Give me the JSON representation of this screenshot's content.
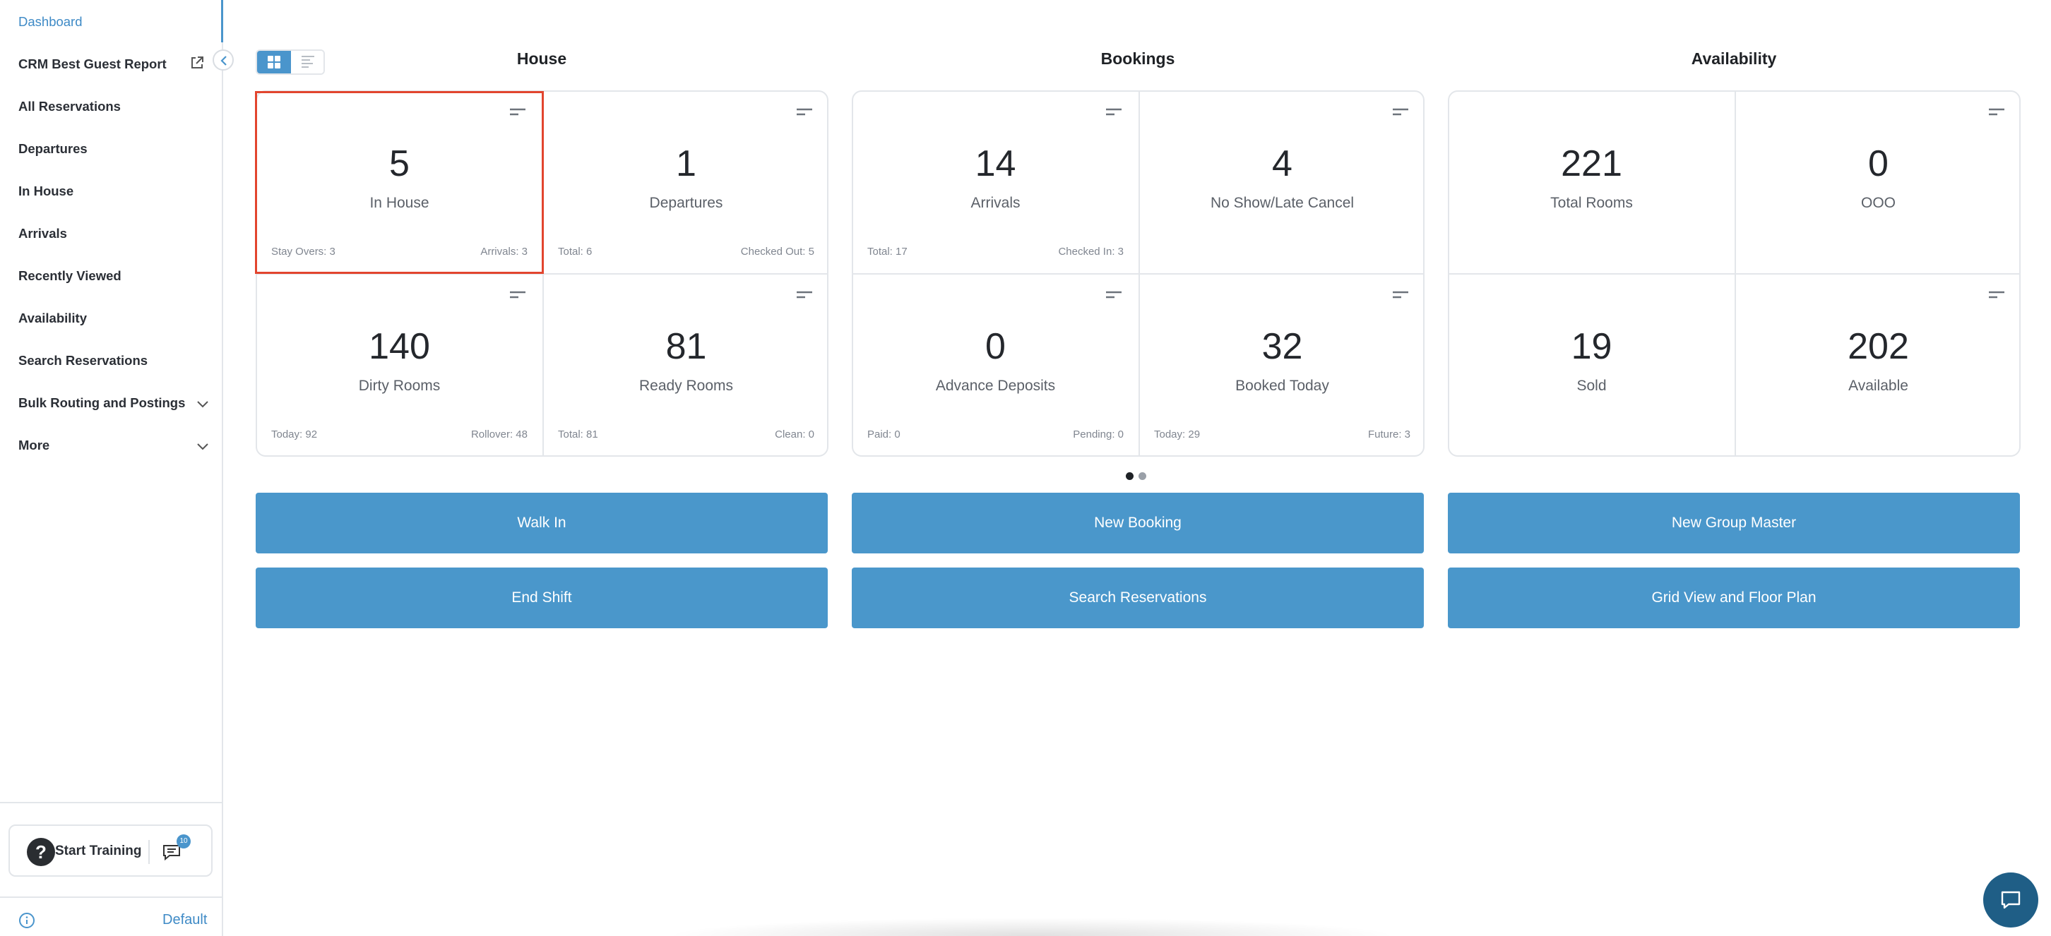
{
  "sidebar": {
    "items": [
      {
        "label": "Dashboard",
        "active": true
      },
      {
        "label": "CRM Best Guest Report",
        "external": true
      },
      {
        "label": "All Reservations"
      },
      {
        "label": "Departures"
      },
      {
        "label": "In House"
      },
      {
        "label": "Arrivals"
      },
      {
        "label": "Recently Viewed"
      },
      {
        "label": "Availability"
      },
      {
        "label": "Search Reservations"
      },
      {
        "label": "Bulk Routing and Postings",
        "expandable": true
      },
      {
        "label": "More",
        "expandable": true
      }
    ],
    "training_label": "Start Training",
    "chat_badge": "10",
    "footer_link": "Default"
  },
  "sections": [
    {
      "title": "House",
      "tiles": [
        {
          "value": "5",
          "label": "In House",
          "foot_left": "Stay Overs: 3",
          "foot_right": "Arrivals: 3"
        },
        {
          "value": "1",
          "label": "Departures",
          "foot_left": "Total: 6",
          "foot_right": "Checked Out: 5"
        },
        {
          "value": "140",
          "label": "Dirty Rooms",
          "foot_left": "Today: 92",
          "foot_right": "Rollover: 48"
        },
        {
          "value": "81",
          "label": "Ready Rooms",
          "foot_left": "Total: 81",
          "foot_right": "Clean: 0"
        }
      ]
    },
    {
      "title": "Bookings",
      "tiles": [
        {
          "value": "14",
          "label": "Arrivals",
          "foot_left": "Total: 17",
          "foot_right": "Checked In: 3"
        },
        {
          "value": "4",
          "label": "No Show/Late Cancel",
          "foot_left": "",
          "foot_right": ""
        },
        {
          "value": "0",
          "label": "Advance Deposits",
          "foot_left": "Paid: 0",
          "foot_right": "Pending: 0"
        },
        {
          "value": "32",
          "label": "Booked Today",
          "foot_left": "Today: 29",
          "foot_right": "Future: 3"
        }
      ]
    },
    {
      "title": "Availability",
      "tiles": [
        {
          "value": "221",
          "label": "Total Rooms",
          "foot_left": "",
          "foot_right": ""
        },
        {
          "value": "0",
          "label": "OOO",
          "foot_left": "",
          "foot_right": ""
        },
        {
          "value": "19",
          "label": "Sold",
          "foot_left": "",
          "foot_right": ""
        },
        {
          "value": "202",
          "label": "Available",
          "foot_left": "",
          "foot_right": ""
        }
      ]
    }
  ],
  "actions": [
    "Walk In",
    "New Booking",
    "New Group Master",
    "End Shift",
    "Search Reservations",
    "Grid View and Floor Plan"
  ],
  "pager": {
    "pages": 2,
    "current": 1
  },
  "colors": {
    "accent": "#4a95cc",
    "button": "#4a97cb",
    "highlight": "#e2452e",
    "fab": "#1f5e86"
  },
  "icons": [
    "external-link-icon",
    "chevron-left-icon",
    "chevron-down-icon",
    "grid-view-icon",
    "list-view-icon",
    "tile-menu-icon",
    "help-icon",
    "chat-icon",
    "info-icon"
  ]
}
